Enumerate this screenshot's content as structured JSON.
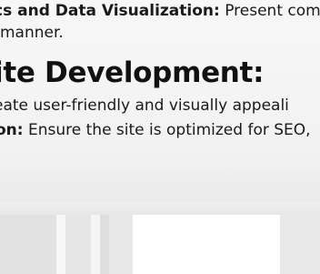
{
  "text": {
    "line1_bold": "cs and Data Visualization:",
    "line1_rest": " Present com",
    "line2": "manner.",
    "heading": "ite Development:",
    "line3": "eate user-friendly and visually appeali",
    "line4_bold": "on:",
    "line4_rest": " Ensure the site is optimized for SEO,"
  },
  "colors": {
    "text": "#1a1a1a",
    "heading": "#111111",
    "background": "#f5f5f5"
  }
}
